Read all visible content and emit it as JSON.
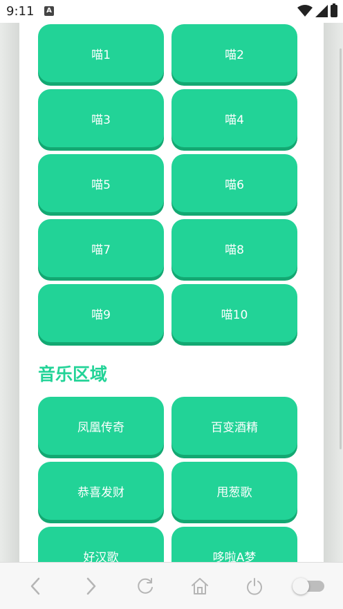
{
  "status_bar": {
    "time": "9:11",
    "notification_letter": "A",
    "icons": [
      "wifi-icon",
      "cell-signal-icon",
      "battery-icon"
    ]
  },
  "meow_buttons": [
    {
      "label": "喵1"
    },
    {
      "label": "喵2"
    },
    {
      "label": "喵3"
    },
    {
      "label": "喵4"
    },
    {
      "label": "喵5"
    },
    {
      "label": "喵6"
    },
    {
      "label": "喵7"
    },
    {
      "label": "喵8"
    },
    {
      "label": "喵9"
    },
    {
      "label": "喵10"
    }
  ],
  "music_section": {
    "title": "音乐区域",
    "buttons": [
      {
        "label": "凤凰传奇"
      },
      {
        "label": "百变酒精"
      },
      {
        "label": "恭喜发财"
      },
      {
        "label": "甩葱歌"
      },
      {
        "label": "好汉歌"
      },
      {
        "label": "哆啦A梦"
      }
    ]
  },
  "bottom_bar": {
    "icons": [
      "back-icon",
      "forward-icon",
      "reload-icon",
      "home-icon",
      "power-icon",
      "toggle-switch"
    ]
  },
  "colors": {
    "accent": "#22d397",
    "accent_shadow": "#13a872",
    "backdrop": "#e6e8e6"
  }
}
